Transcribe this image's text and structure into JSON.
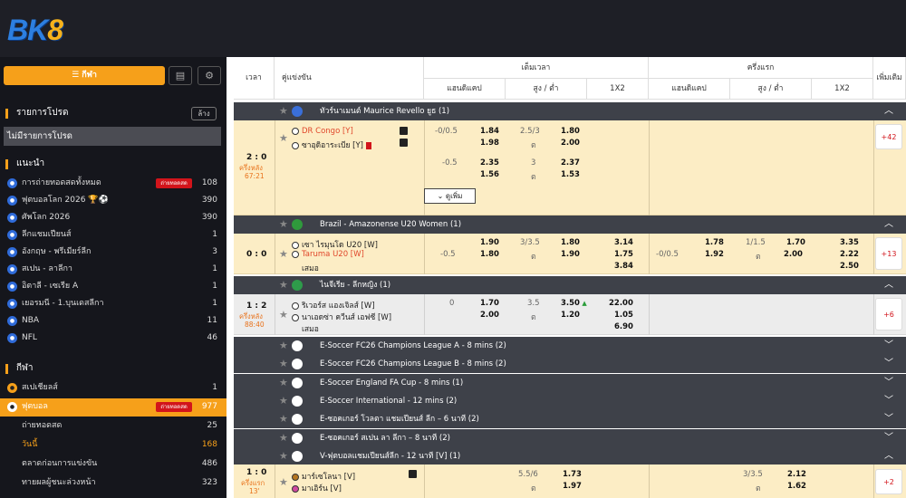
{
  "logo": {
    "bk": "BK",
    "eight": "8"
  },
  "sidebar": {
    "sport_tab": "กีฬา",
    "fav_title": "รายการโปรด",
    "clear": "ล้าง",
    "no_fav": "ไม่มีรายการโปรด",
    "rec_title": "แนะนำ",
    "rec": [
      {
        "label": "การถ่ายทอดสดทั้งหมด",
        "live": "ถ่ายทอดสด",
        "count": "108"
      },
      {
        "label": "ฟุตบอลโลก 2026 🏆⚽",
        "count": "390"
      },
      {
        "label": "ศัพโลก 2026",
        "count": "390"
      },
      {
        "label": "ลีกแชมเปียนส์",
        "count": "1"
      },
      {
        "label": "อังกฤษ - พรีเมียร์ลีก",
        "count": "3"
      },
      {
        "label": "สเปน - ลาลีกา",
        "count": "1"
      },
      {
        "label": "อิตาลี - เซเรีย A",
        "count": "1"
      },
      {
        "label": "เยอรมนี - 1.บุนเดสลีกา",
        "count": "1"
      },
      {
        "label": "NBA",
        "count": "11"
      },
      {
        "label": "NFL",
        "count": "46"
      }
    ],
    "sports_title": "กีฬา",
    "sports": [
      {
        "label": "สเปเชียลส์",
        "count": "1"
      },
      {
        "label": "ฟุตบอล",
        "live": "ถ่ายทอดสด",
        "count": "977"
      }
    ],
    "sub": [
      {
        "label": "ถ่ายทอดสด",
        "count": "25"
      },
      {
        "label": "วันนี้",
        "count": "168"
      },
      {
        "label": "ตลาดก่อนการแข่งขัน",
        "count": "486"
      },
      {
        "label": "ทายผลผู้ชนะล่วงหน้า",
        "count": "323"
      }
    ]
  },
  "header": {
    "time": "เวลา",
    "match": "คู่แข่งขัน",
    "fulltime": "เต็มเวลา",
    "firsthalf": "ครึ่งแรก",
    "handicap": "แฮนดิแคป",
    "ou": "สูง / ต่ำ",
    "x12": "1X2",
    "more": "เพิ่มเติม"
  },
  "leagues": [
    {
      "name": "ทัวร์นาเมนต์ Maurice Revello ยูธ (1)"
    },
    {
      "name": "Brazil - Amazonense U20 Women (1)"
    },
    {
      "name": "ไนจีเรีย - ลีกหญิง (1)"
    },
    {
      "name": "E-Soccer FC26 Champions League A - 8 mins (2)"
    },
    {
      "name": "E-Soccer FC26 Champions League B - 8 mins (2)"
    },
    {
      "name": "E-Soccer England FA Cup - 8 mins (1)"
    },
    {
      "name": "E-Soccer International - 12 mins (2)"
    },
    {
      "name": "E-ซอคเกอร์ โวลตา แชมเปียนส์ ลีก – 6 นาที (2)"
    },
    {
      "name": "E-ซอคเกอร์ สเปน ลา ลีกา – 8 นาที (2)"
    },
    {
      "name": "V-ฟุตบอลแชมเปียนส์ลีก - 12 นาที [V] (1)"
    }
  ],
  "m1": {
    "score": "2 : 0",
    "status": "ครึ่งหลัง",
    "clock": "67:21",
    "home": "DR Congo [Y]",
    "away": "ซาอุดิอาระเบีย [Y]",
    "l1": {
      "hdp": "-0/0.5",
      "h": "1.84",
      "a": "1.98",
      "ou": "2.5/3",
      "o": "1.80",
      "u": "2.00",
      "uflag": "ต"
    },
    "l2": {
      "hdp": "-0.5",
      "h": "2.35",
      "a": "1.56",
      "ou": "3",
      "o": "2.37",
      "u": "1.53",
      "uflag": "ต"
    },
    "more": "+42",
    "more_btn": "ดูเพิ่ม"
  },
  "m2": {
    "score": "0 : 0",
    "home": "เซา ไรมุนโด U20 [W]",
    "away": "Taruma U20 [W]",
    "draw": "เสมอ",
    "hdp": "-0.5",
    "h": "1.90",
    "a": "1.80",
    "ou": "3/3.5",
    "o": "1.80",
    "u": "1.90",
    "uflag": "ต",
    "x1": "3.14",
    "x2": "1.75",
    "xd": "3.84",
    "fh_hdp": "-0/0.5",
    "fh_h": "1.78",
    "fh_a": "1.92",
    "fh_ou": "1/1.5",
    "fh_o": "1.70",
    "fh_u": "2.00",
    "fh_uflag": "ต",
    "fh_x1": "3.35",
    "fh_x2": "2.22",
    "fh_xd": "2.50",
    "more": "+13"
  },
  "m3": {
    "score": "1 : 2",
    "status": "ครึ่งหลัง",
    "clock": "88:40",
    "home": "ริเวอร์ส แองเจิลส์ [W]",
    "away": "นาเอดซ่า ควีนส์ เอฟซี [W]",
    "draw": "เสมอ",
    "hdp": "0",
    "h": "1.70",
    "a": "2.00",
    "ou": "3.5",
    "o": "3.50",
    "u": "1.20",
    "uflag": "ต",
    "x1": "22.00",
    "x2": "1.05",
    "xd": "6.90",
    "more": "+6"
  },
  "m4": {
    "score": "1 : 0",
    "status": "ครึ่งแรก",
    "clock": "13'",
    "home": "มาร์เซโลนา [V]",
    "away": "มาเอิร์น [V]",
    "ou": "5.5/6",
    "o": "1.73",
    "u": "1.97",
    "uflag": "ต",
    "fh_ou": "3/3.5",
    "fh_o": "2.12",
    "fh_u": "1.62",
    "fh_uflag": "ต",
    "more": "+2"
  }
}
